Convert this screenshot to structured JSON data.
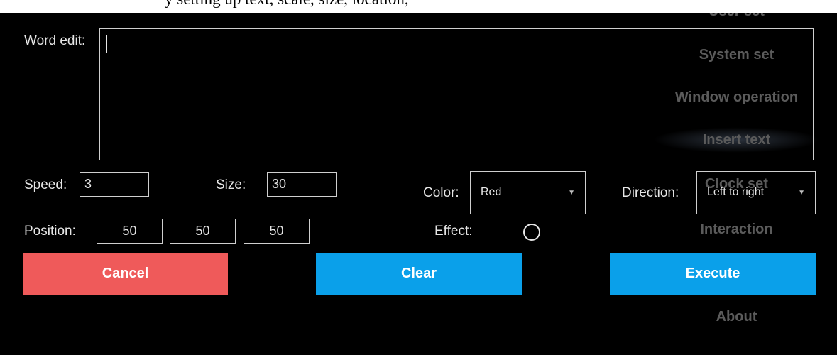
{
  "caption": {
    "text": "y setting up text, scale, size, location, "
  },
  "menu": {
    "items": [
      {
        "label": "User set"
      },
      {
        "label": "System set"
      },
      {
        "label": "Window operation"
      },
      {
        "label": "Insert text"
      },
      {
        "label": "Clock set"
      },
      {
        "label": "Interaction"
      },
      {
        "label": "About"
      }
    ]
  },
  "form": {
    "word_edit_label": "Word edit:",
    "word_edit_value": "",
    "speed_label": "Speed:",
    "speed_value": "3",
    "size_label": "Size:",
    "size_value": "30",
    "color_label": "Color:",
    "color_value": "Red",
    "direction_label": "Direction:",
    "direction_value": "Left to right",
    "position_label": "Position:",
    "position_values": [
      "50",
      "50",
      "50"
    ],
    "effect_label": "Effect:"
  },
  "buttons": {
    "cancel": "Cancel",
    "clear": "Clear",
    "execute": "Execute"
  },
  "colors": {
    "background": "#000000",
    "cancel": "#ef5a5a",
    "clear": "#0aa0ea",
    "execute": "#0aa0ea",
    "menu_text": "#5b5b5b"
  }
}
